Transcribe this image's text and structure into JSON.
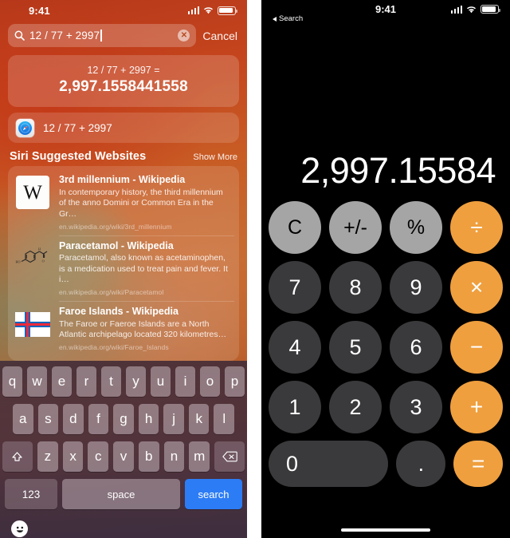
{
  "left": {
    "status": {
      "time": "9:41",
      "signal_icon": "cellular-bars-icon",
      "wifi_icon": "wifi-icon",
      "battery_icon": "battery-icon"
    },
    "search": {
      "icon": "search-icon",
      "value": "12 / 77 + 2997",
      "placeholder": "Search",
      "clear_icon": "clear-circle-icon",
      "clear_glyph": "✕",
      "cancel_label": "Cancel"
    },
    "result_card": {
      "expression": "12 / 77 + 2997 =",
      "result": "2,997.1558441558"
    },
    "safari_suggestion": {
      "icon": "safari-icon",
      "label": "12 / 77 + 2997"
    },
    "siri_section": {
      "title": "Siri Suggested Websites",
      "show_more_label": "Show More"
    },
    "sites": [
      {
        "thumb": "wikipedia-logo-icon",
        "thumb_glyph": "W",
        "title": "3rd millennium - Wikipedia",
        "description": "In contemporary history, the third millennium of the anno Domini or Common Era in the Gr…",
        "url": "en.wikipedia.org/wiki/3rd_millennium"
      },
      {
        "thumb": "paracetamol-structure-icon",
        "title": "Paracetamol - Wikipedia",
        "description": "Paracetamol, also known as acetaminophen, is a medication used to treat pain and fever. It i…",
        "url": "en.wikipedia.org/wiki/Paracetamol"
      },
      {
        "thumb": "faroe-islands-flag-icon",
        "title": "Faroe Islands - Wikipedia",
        "description": "The Faroe or Faeroe Islands are a North Atlantic archipelago located 320 kilometres…",
        "url": "en.wikipedia.org/wiki/Faroe_Islands"
      }
    ],
    "keyboard": {
      "row1": [
        "q",
        "w",
        "e",
        "r",
        "t",
        "y",
        "u",
        "i",
        "o",
        "p"
      ],
      "row2": [
        "a",
        "s",
        "d",
        "f",
        "g",
        "h",
        "j",
        "k",
        "l"
      ],
      "row3": [
        "z",
        "x",
        "c",
        "v",
        "b",
        "n",
        "m"
      ],
      "shift_icon": "shift-arrow-icon",
      "backspace_icon": "backspace-icon",
      "numeric_label": "123",
      "space_label": "space",
      "search_label": "search",
      "emoji_icon": "emoji-smiley-icon",
      "search_key_color": "#2c7cf6"
    }
  },
  "right": {
    "status": {
      "time": "9:41",
      "back_label": "Search",
      "back_icon": "back-triangle-icon",
      "signal_icon": "cellular-bars-icon",
      "wifi_icon": "wifi-icon",
      "battery_icon": "battery-icon"
    },
    "display": "2,997.15584",
    "colors": {
      "operator": "#ef9f3e",
      "function": "#a5a5a5",
      "digit": "#3a3a3c",
      "background": "#000000"
    },
    "keys": {
      "r1": [
        "C",
        "+/-",
        "%",
        "÷"
      ],
      "r2": [
        "7",
        "8",
        "9",
        "×"
      ],
      "r3": [
        "4",
        "5",
        "6",
        "−"
      ],
      "r4": [
        "1",
        "2",
        "3",
        "+"
      ],
      "r5": [
        "0",
        ".",
        "="
      ]
    },
    "home_indicator": "home-indicator"
  }
}
